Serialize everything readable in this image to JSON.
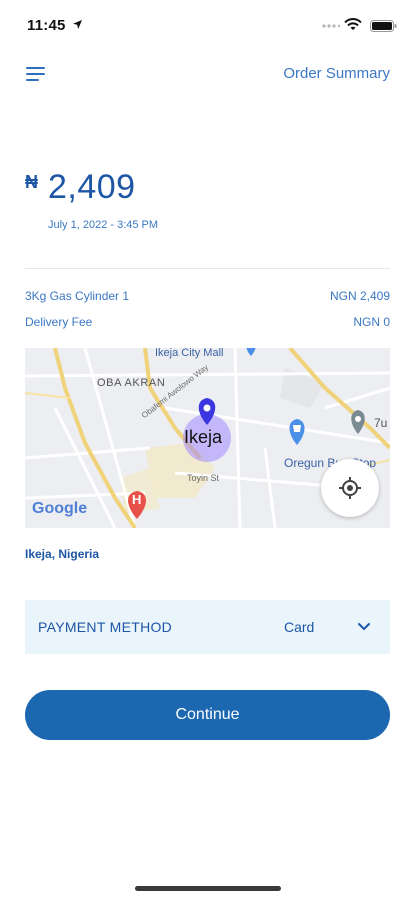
{
  "status_bar": {
    "time": "11:45"
  },
  "header": {
    "menu_icon": "hamburger-menu-icon",
    "title": "Order Summary"
  },
  "order": {
    "currency_symbol": "₦",
    "amount": "2,409",
    "date": "July 1, 2022 - 3:45 PM",
    "items": [
      {
        "label": "3Kg Gas Cylinder 1",
        "value": "NGN 2,409"
      },
      {
        "label": "Delivery Fee",
        "value": "NGN 0"
      }
    ]
  },
  "map": {
    "labels": {
      "mall": "Ikeja City Mall",
      "district": "OBA AKRAN",
      "street_avenue": "Obafemi Awolowo Way",
      "street_toyin": "Toyin St",
      "oregun": "Oregun Bus Stop",
      "seven_up": "7u",
      "pin_label": "Ikeja",
      "hospital_letter": "H",
      "google": "Google"
    },
    "location_button_icon": "my-location-icon"
  },
  "location": "Ikeja, Nigeria",
  "payment": {
    "label": "PAYMENT METHOD",
    "value": "Card",
    "icon": "chevron-down-icon"
  },
  "continue_label": "Continue",
  "colors": {
    "primary": "#1b67b0",
    "accent_text": "#3a78c4",
    "payment_bg": "#eaf4fb"
  }
}
